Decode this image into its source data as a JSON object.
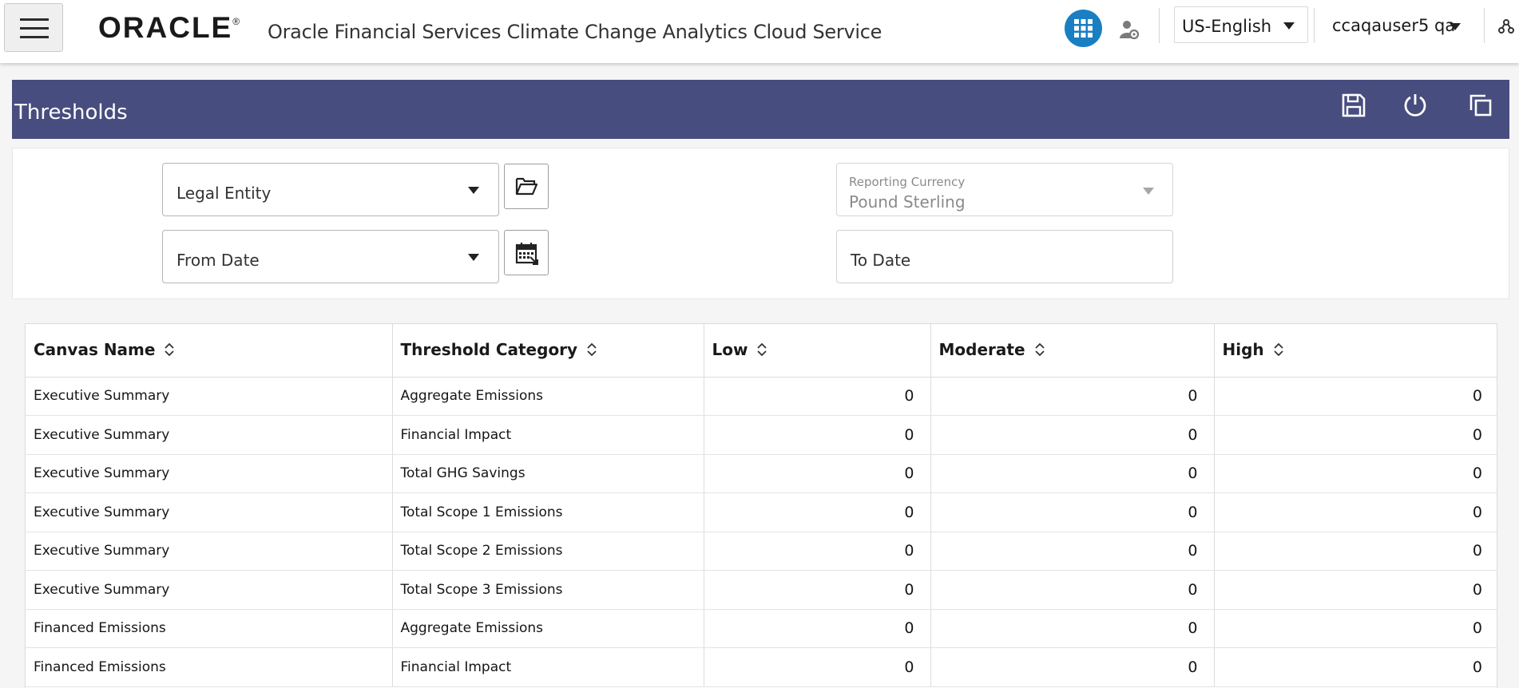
{
  "header": {
    "logo_text": "ORACLE",
    "logo_mark": "®",
    "app_title": "Oracle Financial Services Climate Change Analytics Cloud Service",
    "language": "US-English",
    "user": "ccaqauser5 qa",
    "icons": [
      "hamburger-menu-icon",
      "apps-grid-icon",
      "user-settings-icon",
      "hierarchy-icon"
    ]
  },
  "page": {
    "title": "Thresholds",
    "toolbar_icons": [
      "save-icon",
      "reset-icon",
      "copy-icon"
    ]
  },
  "filters": {
    "legal_entity": "Legal Entity",
    "from_date": "From Date",
    "reporting_currency_label": "Reporting Currency",
    "reporting_currency_value": "Pound Sterling",
    "to_date": "To Date"
  },
  "table": {
    "columns": [
      "Canvas Name",
      "Threshold Category",
      "Low",
      "Moderate",
      "High"
    ],
    "rows": [
      [
        "Executive Summary",
        "Aggregate Emissions",
        "0",
        "0",
        "0"
      ],
      [
        "Executive Summary",
        "Financial Impact",
        "0",
        "0",
        "0"
      ],
      [
        "Executive Summary",
        "Total GHG Savings",
        "0",
        "0",
        "0"
      ],
      [
        "Executive Summary",
        "Total Scope 1 Emissions",
        "0",
        "0",
        "0"
      ],
      [
        "Executive Summary",
        "Total Scope 2 Emissions",
        "0",
        "0",
        "0"
      ],
      [
        "Executive Summary",
        "Total Scope 3 Emissions",
        "0",
        "0",
        "0"
      ],
      [
        "Financed Emissions",
        "Aggregate Emissions",
        "0",
        "0",
        "0"
      ],
      [
        "Financed Emissions",
        "Financial Impact",
        "0",
        "0",
        "0"
      ]
    ]
  },
  "colors": {
    "title_bar": "#474d7e",
    "apps_button": "#1a7ec2"
  }
}
